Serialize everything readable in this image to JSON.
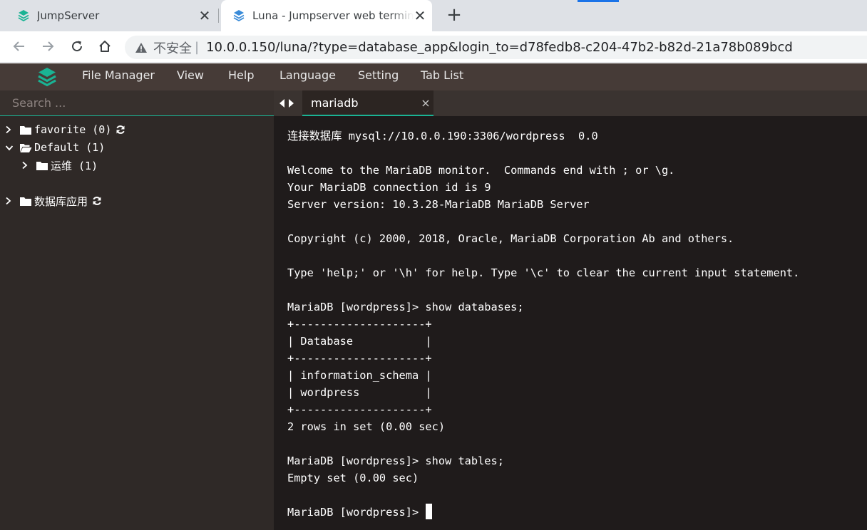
{
  "browser": {
    "tabs": [
      {
        "title": "JumpServer",
        "active": false
      },
      {
        "title": "Luna - Jumpserver web terminal",
        "active": true
      }
    ],
    "new_tab_symbol": "+",
    "close_symbol": "✕",
    "address": {
      "security_label": "不安全",
      "separator": "|",
      "url": "10.0.0.150/luna/?type=database_app&login_to=d78fedb8-c204-47b2-b82d-21a78b089bcd"
    }
  },
  "app": {
    "menu": [
      "File Manager",
      "View",
      "Help",
      "Language",
      "Setting",
      "Tab List"
    ],
    "accent_color": "#1ab394",
    "menubar_color": "#463b37"
  },
  "tree": {
    "search_placeholder": "Search ...",
    "nodes": [
      {
        "label": "favorite (0)",
        "expanded": false
      },
      {
        "label": "Default (1)",
        "expanded": true
      },
      {
        "label": "运维 (1)",
        "expanded": false
      },
      {
        "label": "数据库应用",
        "expanded": false
      }
    ]
  },
  "session": {
    "tab_label": "mariadb",
    "close_symbol": "×"
  },
  "terminal": {
    "lines": [
      "连接数据库 mysql://10.0.0.190:3306/wordpress  0.0",
      "",
      "Welcome to the MariaDB monitor.  Commands end with ; or \\g.",
      "Your MariaDB connection id is 9",
      "Server version: 10.3.28-MariaDB MariaDB Server",
      "",
      "Copyright (c) 2000, 2018, Oracle, MariaDB Corporation Ab and others.",
      "",
      "Type 'help;' or '\\h' for help. Type '\\c' to clear the current input statement.",
      "",
      "MariaDB [wordpress]> show databases;",
      "+--------------------+",
      "| Database           |",
      "+--------------------+",
      "| information_schema |",
      "| wordpress          |",
      "+--------------------+",
      "2 rows in set (0.00 sec)",
      "",
      "MariaDB [wordpress]> show tables;",
      "Empty set (0.00 sec)",
      ""
    ],
    "prompt": "MariaDB [wordpress]> "
  }
}
